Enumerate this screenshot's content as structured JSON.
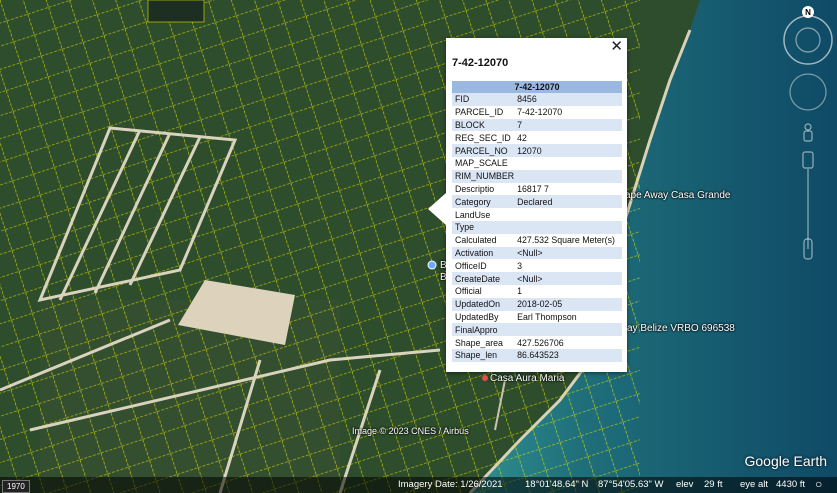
{
  "popup": {
    "title": "7-42-12070",
    "table_header": "7-42-12070",
    "close_icon": "close-icon",
    "rows": [
      {
        "key": "FID",
        "value": "8456"
      },
      {
        "key": "PARCEL_ID",
        "value": "7-42-12070"
      },
      {
        "key": "BLOCK",
        "value": "7"
      },
      {
        "key": "REG_SEC_ID",
        "value": "42"
      },
      {
        "key": "PARCEL_NO",
        "value": "12070"
      },
      {
        "key": "MAP_SCALE",
        "value": ""
      },
      {
        "key": "RIM_NUMBER",
        "value": ""
      },
      {
        "key": "Descriptio",
        "value": "16817 7"
      },
      {
        "key": "Category",
        "value": "Declared"
      },
      {
        "key": "LandUse",
        "value": ""
      },
      {
        "key": "Type",
        "value": ""
      },
      {
        "key": "Calculated",
        "value": "427.532 Square Meter(s)"
      },
      {
        "key": "Activation",
        "value": "<Null>"
      },
      {
        "key": "OfficeID",
        "value": "3"
      },
      {
        "key": "CreateDate",
        "value": "<Null>"
      },
      {
        "key": "Official",
        "value": "1"
      },
      {
        "key": "UpdatedOn",
        "value": "2018-02-05"
      },
      {
        "key": "UpdatedBy",
        "value": "Earl Thompson"
      },
      {
        "key": "FinalAppro",
        "value": ""
      },
      {
        "key": "Shape_area",
        "value": "427.526706"
      },
      {
        "key": "Shape_len",
        "value": "86.643523"
      }
    ]
  },
  "map_labels": {
    "place1": "ape Away Casa Grande",
    "place2": "ay Belize VRBO 696538",
    "place3": "Casa Aura Maria",
    "place4": "B",
    "place5": "B",
    "copyright": "Image © 2023 CNES / Airbus"
  },
  "status_bar": {
    "imagery_date": "Imagery Date: 1/26/2021",
    "lat": "18°01'48.64\" N",
    "lon": "87°54'05.63\" W",
    "elev_label": "elev",
    "elev_value": "29 ft",
    "eye_alt_label": "eye alt",
    "eye_alt_value": "4430 ft"
  },
  "history": {
    "year": "1970"
  },
  "navigation": {
    "north_label": "N"
  },
  "logo": "Google Earth",
  "colors": {
    "popup_header": "#9ab8e0",
    "row_alt": "#dbe6f5",
    "parcel_lines": "#e6e600",
    "water": "#1d6f7a"
  }
}
